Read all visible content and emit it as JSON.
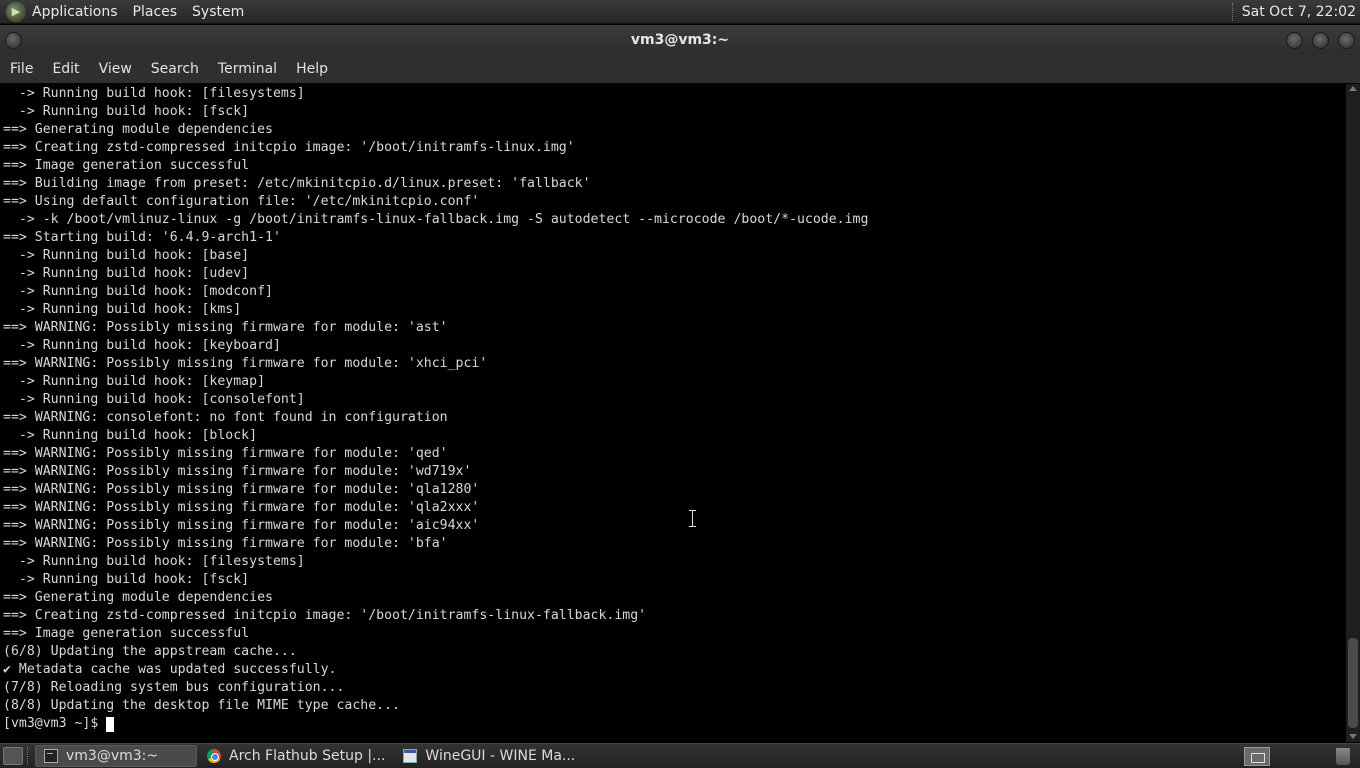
{
  "top_panel": {
    "menus": [
      "Applications",
      "Places",
      "System"
    ],
    "clock": "Sat Oct  7, 22:02"
  },
  "window": {
    "title": "vm3@vm3:~"
  },
  "menubar": [
    "File",
    "Edit",
    "View",
    "Search",
    "Terminal",
    "Help"
  ],
  "terminal": {
    "lines": [
      "  -> Running build hook: [filesystems]",
      "  -> Running build hook: [fsck]",
      "==> Generating module dependencies",
      "==> Creating zstd-compressed initcpio image: '/boot/initramfs-linux.img'",
      "==> Image generation successful",
      "==> Building image from preset: /etc/mkinitcpio.d/linux.preset: 'fallback'",
      "==> Using default configuration file: '/etc/mkinitcpio.conf'",
      "  -> -k /boot/vmlinuz-linux -g /boot/initramfs-linux-fallback.img -S autodetect --microcode /boot/*-ucode.img",
      "==> Starting build: '6.4.9-arch1-1'",
      "  -> Running build hook: [base]",
      "  -> Running build hook: [udev]",
      "  -> Running build hook: [modconf]",
      "  -> Running build hook: [kms]",
      "==> WARNING: Possibly missing firmware for module: 'ast'",
      "  -> Running build hook: [keyboard]",
      "==> WARNING: Possibly missing firmware for module: 'xhci_pci'",
      "  -> Running build hook: [keymap]",
      "  -> Running build hook: [consolefont]",
      "==> WARNING: consolefont: no font found in configuration",
      "  -> Running build hook: [block]",
      "==> WARNING: Possibly missing firmware for module: 'qed'",
      "==> WARNING: Possibly missing firmware for module: 'wd719x'",
      "==> WARNING: Possibly missing firmware for module: 'qla1280'",
      "==> WARNING: Possibly missing firmware for module: 'qla2xxx'",
      "==> WARNING: Possibly missing firmware for module: 'aic94xx'",
      "==> WARNING: Possibly missing firmware for module: 'bfa'",
      "  -> Running build hook: [filesystems]",
      "  -> Running build hook: [fsck]",
      "==> Generating module dependencies",
      "==> Creating zstd-compressed initcpio image: '/boot/initramfs-linux-fallback.img'",
      "==> Image generation successful",
      "(6/8) Updating the appstream cache...",
      "✔ Metadata cache was updated successfully.",
      "(7/8) Reloading system bus configuration...",
      "(8/8) Updating the desktop file MIME type cache..."
    ],
    "prompt": "[vm3@vm3 ~]$ "
  },
  "taskbar": {
    "tasks": [
      {
        "label": "vm3@vm3:~",
        "icon": "terminal-icon",
        "active": true
      },
      {
        "label": "Arch Flathub Setup |...",
        "icon": "chrome-icon",
        "active": false
      },
      {
        "label": "WineGUI - WINE Ma...",
        "icon": "wine-icon",
        "active": false
      }
    ]
  }
}
